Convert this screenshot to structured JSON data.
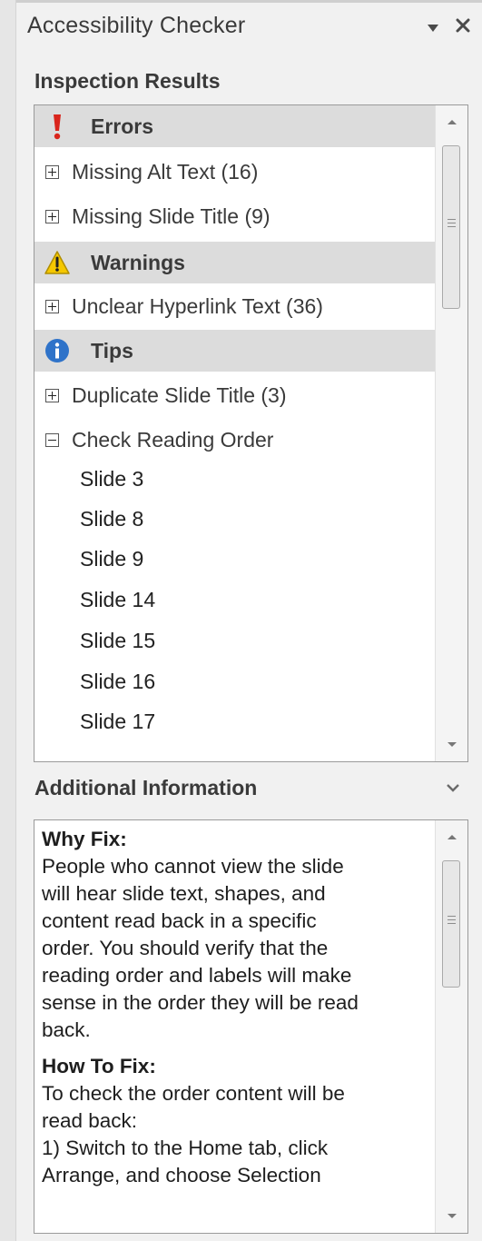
{
  "pane": {
    "title": "Accessibility Checker",
    "menu_icon": "dropdown-arrow-icon",
    "close_icon": "close-icon"
  },
  "inspection": {
    "label": "Inspection Results",
    "categories": [
      {
        "label": "Errors",
        "icon": "error-exclamation-icon",
        "color": "#d9251c"
      },
      {
        "label": "Warnings",
        "icon": "warning-triangle-icon",
        "color": "#f5c800"
      },
      {
        "label": "Tips",
        "icon": "info-icon",
        "color": "#2f73c9"
      }
    ],
    "items": [
      "Missing Alt Text (16)",
      "Missing Slide Title (9)",
      "Unclear Hyperlink Text (36)",
      "Duplicate Slide Title (3)",
      "Check Reading Order"
    ],
    "slides": [
      "Slide 3",
      "Slide 8",
      "Slide 9",
      "Slide 14",
      "Slide 15",
      "Slide 16",
      "Slide 17"
    ]
  },
  "additional": {
    "label": "Additional Information",
    "why_heading": "Why Fix:",
    "why_text": "People who cannot view the slide\nwill hear slide text, shapes, and\ncontent read back in a specific\norder. You should verify that the\nreading order and labels will make\nsense in the order they will be read\nback.",
    "how_heading": "How To Fix:",
    "how_text": "To check the order content will be\nread back:\n1) Switch to the Home tab, click\nArrange, and choose Selection"
  }
}
